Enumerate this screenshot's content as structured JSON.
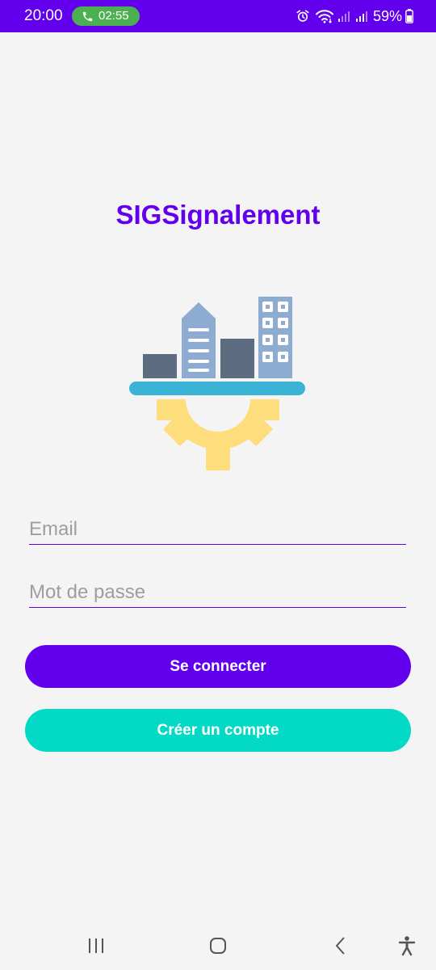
{
  "status_bar": {
    "time": "20:00",
    "call_duration": "02:55",
    "battery": "59%",
    "background": "#6200ee",
    "call_pill_color": "#4caf50"
  },
  "app": {
    "title": "SIGSignalement",
    "logo_icon": "city-gear-icon"
  },
  "form": {
    "email_placeholder": "Email",
    "email_value": "",
    "password_placeholder": "Mot de passe",
    "password_value": ""
  },
  "buttons": {
    "login_label": "Se connecter",
    "register_label": "Créer un compte"
  },
  "nav_bar": {
    "recents_icon": "recents-icon",
    "home_icon": "home-icon",
    "back_icon": "back-icon",
    "accessibility_icon": "accessibility-icon"
  },
  "colors": {
    "primary": "#6200ee",
    "secondary": "#03dac5",
    "background": "#f4f4f4",
    "placeholder": "#9e9e9e"
  }
}
